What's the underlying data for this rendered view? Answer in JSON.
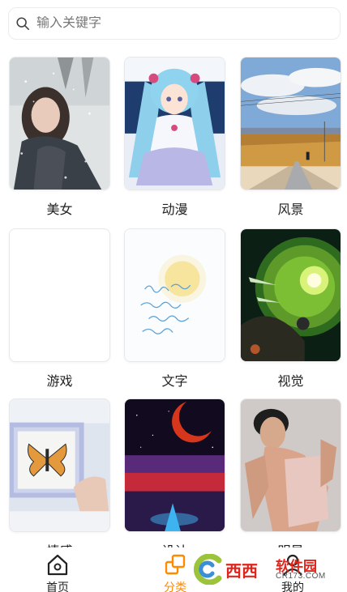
{
  "search": {
    "placeholder": "输入关键字",
    "icon": "search-icon"
  },
  "categories": [
    {
      "label": "美女",
      "thumb": "photo-woman-in-snow"
    },
    {
      "label": "动漫",
      "thumb": "anime-girl-blue-hair"
    },
    {
      "label": "风景",
      "thumb": "landscape-road-autumn"
    },
    {
      "label": "游戏",
      "thumb": "blank"
    },
    {
      "label": "文字",
      "thumb": "handwritten-text-sun"
    },
    {
      "label": "视觉",
      "thumb": "green-planet-space"
    },
    {
      "label": "情感",
      "thumb": "butterfly-photo-frame"
    },
    {
      "label": "设计",
      "thumb": "red-crescent-space"
    },
    {
      "label": "明星",
      "thumb": "male-star-portrait"
    }
  ],
  "tabbar": {
    "tabs": [
      {
        "label": "首页",
        "icon": "home-icon",
        "active": false
      },
      {
        "label": "分类",
        "icon": "category-icon",
        "active": true
      },
      {
        "label": "我的",
        "icon": "profile-icon",
        "active": false
      }
    ],
    "active_color": "#ff8a00"
  },
  "watermark": {
    "brand": "西西",
    "subtitle": "软件园",
    "url": "CR173.COM"
  },
  "colors": {
    "background": "#ffffff",
    "text": "#222222",
    "accent": "#ff8a00",
    "watermark_red": "#e2231a"
  }
}
